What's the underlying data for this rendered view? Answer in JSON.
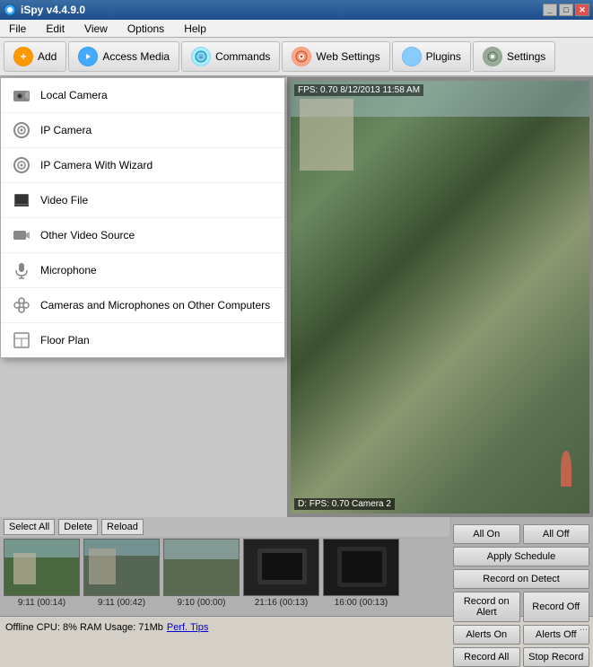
{
  "titlebar": {
    "title": "iSpy v4.4.9.0",
    "controls": [
      "_",
      "□",
      "✕"
    ]
  },
  "menubar": {
    "items": [
      "File",
      "Edit",
      "View",
      "Options",
      "Help"
    ]
  },
  "toolbar": {
    "buttons": [
      {
        "id": "add",
        "label": "Add",
        "icon": "➕",
        "iconClass": "tb-add"
      },
      {
        "id": "access-media",
        "label": "Access Media",
        "icon": "▶",
        "iconClass": "tb-access"
      },
      {
        "id": "commands",
        "label": "Commands",
        "icon": "≡",
        "iconClass": "tb-commands"
      },
      {
        "id": "web-settings",
        "label": "Web Settings",
        "icon": "⊙",
        "iconClass": "tb-websettings"
      },
      {
        "id": "plugins",
        "label": "Plugins",
        "icon": "⊞",
        "iconClass": "tb-plugins"
      },
      {
        "id": "settings",
        "label": "Settings",
        "icon": "⚙",
        "iconClass": "tb-settings"
      }
    ]
  },
  "dropdown": {
    "items": [
      {
        "id": "local-camera",
        "label": "Local Camera",
        "icon": "📷"
      },
      {
        "id": "ip-camera",
        "label": "IP Camera",
        "icon": "⊙"
      },
      {
        "id": "ip-camera-wizard",
        "label": "IP Camera With Wizard",
        "icon": "⊙"
      },
      {
        "id": "video-file",
        "label": "Video File",
        "icon": "🖥"
      },
      {
        "id": "other-video",
        "label": "Other Video Source",
        "icon": "📷"
      },
      {
        "id": "microphone",
        "label": "Microphone",
        "icon": "🎙"
      },
      {
        "id": "cameras-other",
        "label": "Cameras and Microphones on Other Computers",
        "icon": "✦"
      },
      {
        "id": "floor-plan",
        "label": "Floor Plan",
        "icon": "🖨"
      }
    ]
  },
  "camera": {
    "overlay": "FPS: 0.70 8/12/2013 11:58 AM",
    "label": "D: FPS: 0.70  Camera 2"
  },
  "thumbnails": {
    "controls": [
      "Select All",
      "Delete",
      "Reload"
    ],
    "items": [
      {
        "label": "9:11 (00:14)",
        "type": "outdoor"
      },
      {
        "label": "9:11 (00:42)",
        "type": "outdoor"
      },
      {
        "label": "9:10 (00:00)",
        "type": "outdoor"
      },
      {
        "label": "21:16 (00:13)",
        "type": "phone"
      },
      {
        "label": "16:00 (00:13)",
        "type": "phone"
      }
    ]
  },
  "rightControls": {
    "rows": [
      [
        {
          "id": "all-on",
          "label": "All On"
        },
        {
          "id": "all-off",
          "label": "All Off"
        }
      ],
      [
        {
          "id": "apply-schedule",
          "label": "Apply Schedule"
        }
      ],
      [
        {
          "id": "record-on-detect",
          "label": "Record on Detect"
        }
      ],
      [
        {
          "id": "record-on-alert",
          "label": "Record on Alert"
        },
        {
          "id": "record-off",
          "label": "Record Off"
        }
      ],
      [
        {
          "id": "alerts-on",
          "label": "Alerts On"
        },
        {
          "id": "alerts-off",
          "label": "Alerts Off"
        }
      ],
      [
        {
          "id": "record-all",
          "label": "Record All"
        },
        {
          "id": "stop-record",
          "label": "Stop Record"
        }
      ]
    ]
  },
  "statusbar": {
    "text": "Offline  CPU: 8% RAM Usage: 71Mb",
    "link": "Perf. Tips",
    "dots": "..."
  }
}
